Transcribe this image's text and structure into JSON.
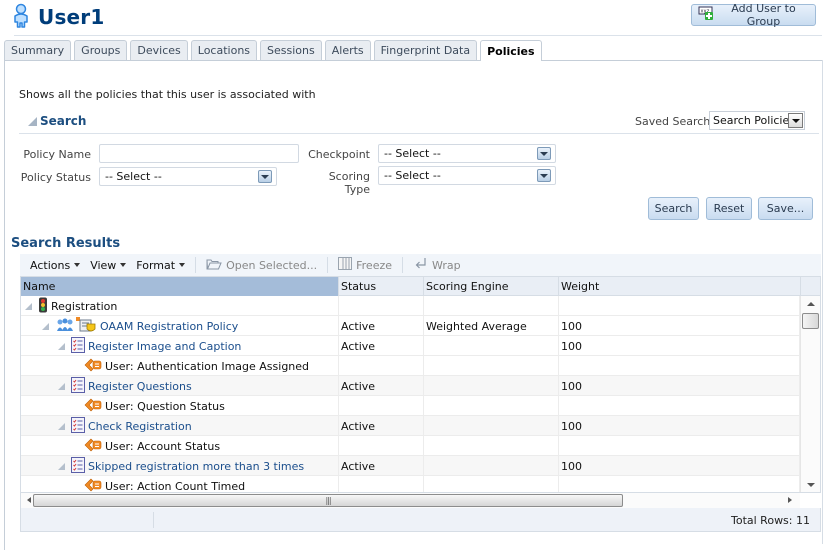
{
  "header": {
    "title": "User1",
    "icon": "user-icon",
    "add_user_to_group_label": "Add User to Group",
    "add_user_to_group_icon": "add-to-group-icon"
  },
  "tabs": [
    {
      "label": "Summary",
      "active": false
    },
    {
      "label": "Groups",
      "active": false
    },
    {
      "label": "Devices",
      "active": false
    },
    {
      "label": "Locations",
      "active": false
    },
    {
      "label": "Sessions",
      "active": false
    },
    {
      "label": "Alerts",
      "active": false
    },
    {
      "label": "Fingerprint Data",
      "active": false
    },
    {
      "label": "Policies",
      "active": true
    }
  ],
  "description": "Shows all the policies that this user is associated with",
  "search": {
    "title": "Search",
    "saved_search_label": "Saved Search",
    "saved_search_value": "Search Policies",
    "fields": {
      "policy_name": {
        "label": "Policy Name",
        "value": "",
        "placeholder": ""
      },
      "policy_status": {
        "label": "Policy Status",
        "value": "-- Select --"
      },
      "checkpoint": {
        "label": "Checkpoint",
        "value": "-- Select --"
      },
      "scoring_type": {
        "label": "Scoring Type",
        "value": "-- Select --"
      }
    },
    "buttons": {
      "search": "Search",
      "reset": "Reset",
      "save": "Save..."
    }
  },
  "results": {
    "title": "Search Results",
    "toolbar": {
      "actions": "Actions",
      "view": "View",
      "format": "Format",
      "open_selected": "Open Selected...",
      "freeze": "Freeze",
      "wrap": "Wrap"
    },
    "columns": [
      "Name",
      "Status",
      "Scoring Engine",
      "Weight"
    ],
    "rows": [
      {
        "level": 0,
        "type": "checkpoint",
        "icon": "traffic-light-icon",
        "name": "Registration",
        "link": false,
        "status": "",
        "engine": "",
        "weight": ""
      },
      {
        "level": 1,
        "type": "policy",
        "icon": "policy-icon",
        "name": "OAAM Registration Policy",
        "link": true,
        "status": "Active",
        "engine": "Weighted Average",
        "weight": "100"
      },
      {
        "level": 2,
        "type": "rule",
        "icon": "rule-checklist-icon",
        "name": "Register Image and Caption",
        "link": true,
        "status": "Active",
        "engine": "",
        "weight": "100"
      },
      {
        "level": 3,
        "type": "condition",
        "icon": "condition-icon",
        "name": "User: Authentication Image Assigned",
        "link": false,
        "status": "",
        "engine": "",
        "weight": ""
      },
      {
        "level": 2,
        "type": "rule",
        "icon": "rule-checklist-icon",
        "name": "Register Questions",
        "link": true,
        "status": "Active",
        "engine": "",
        "weight": "100"
      },
      {
        "level": 3,
        "type": "condition",
        "icon": "condition-icon",
        "name": "User: Question Status",
        "link": false,
        "status": "",
        "engine": "",
        "weight": ""
      },
      {
        "level": 2,
        "type": "rule",
        "icon": "rule-checklist-icon",
        "name": "Check Registration",
        "link": true,
        "status": "Active",
        "engine": "",
        "weight": "100"
      },
      {
        "level": 3,
        "type": "condition",
        "icon": "condition-icon",
        "name": "User: Account Status",
        "link": false,
        "status": "",
        "engine": "",
        "weight": ""
      },
      {
        "level": 2,
        "type": "rule",
        "icon": "rule-checklist-icon",
        "name": "Skipped registration more than 3 times",
        "link": true,
        "status": "Active",
        "engine": "",
        "weight": "100"
      },
      {
        "level": 3,
        "type": "condition",
        "icon": "condition-icon",
        "name": "User: Action Count Timed",
        "link": false,
        "status": "",
        "engine": "",
        "weight": ""
      }
    ],
    "total_rows_label": "Total Rows: 11"
  },
  "colors": {
    "title": "#003d7a",
    "section_title": "#1c4e80",
    "link": "#1b4e8c",
    "selected_column_header": "#a4bcd9",
    "button_top": "#e8f1fb",
    "button_bottom": "#c9dcf0"
  }
}
